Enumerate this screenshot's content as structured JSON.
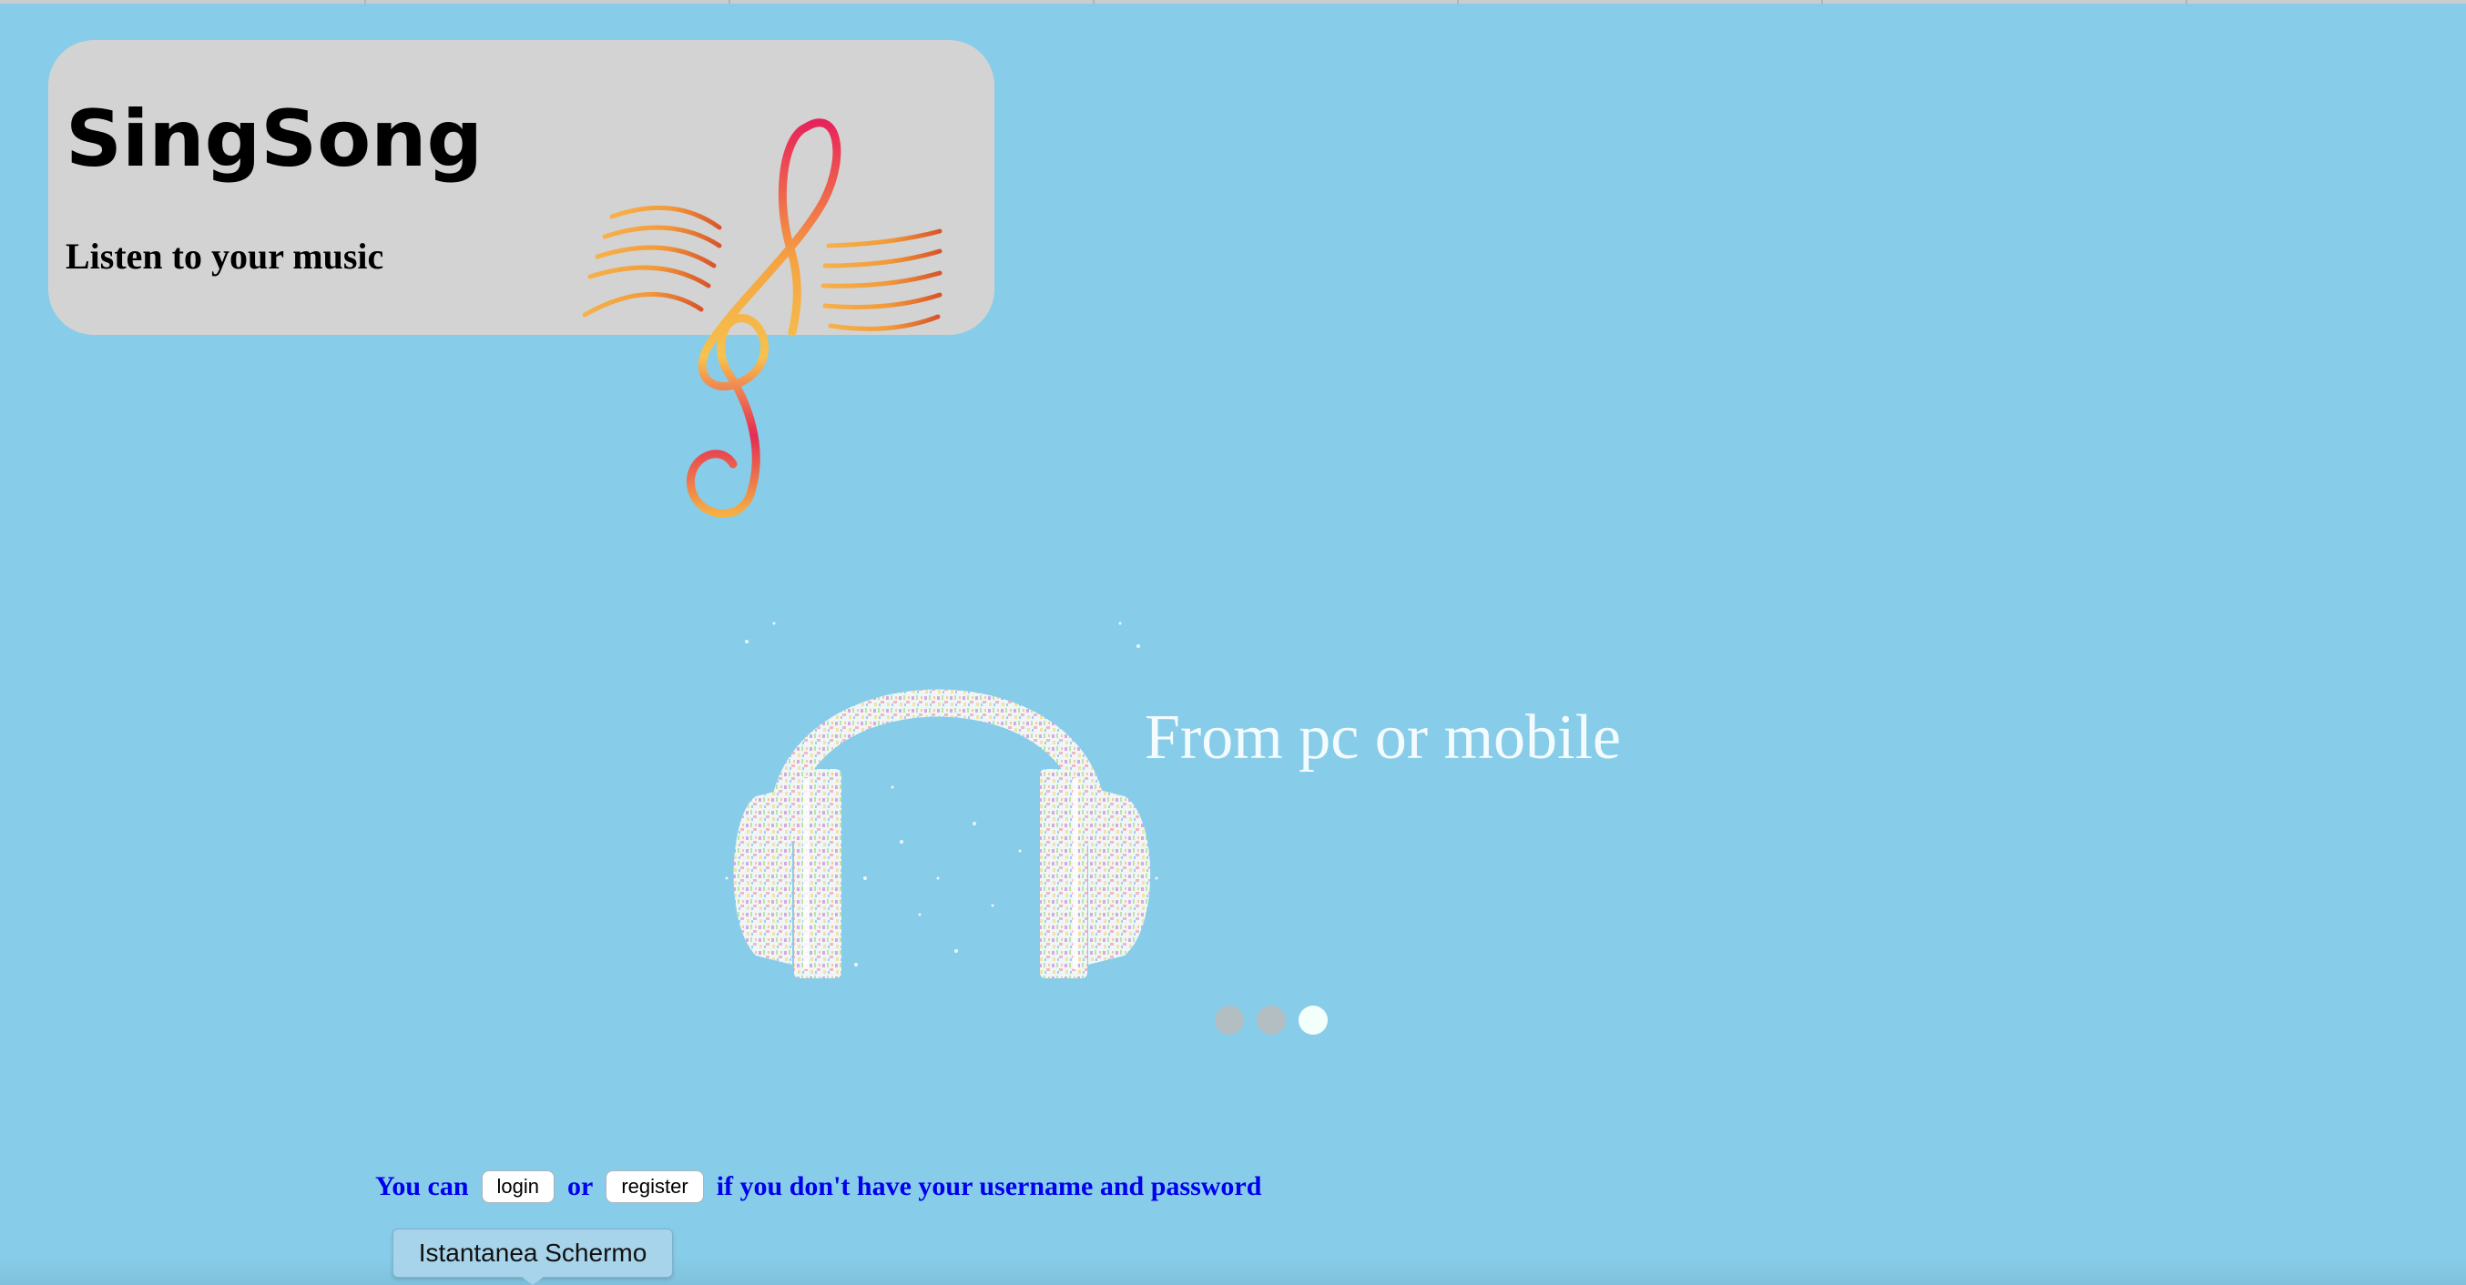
{
  "header": {
    "title": "SingSong",
    "subtitle": "Listen to your music",
    "logo_icon": "treble-clef-icon",
    "background": "#D3D3D3"
  },
  "carousel": {
    "caption": "From pc or mobile",
    "image_icon": "headphones-icon",
    "slide_count": 3,
    "active_slide": 3
  },
  "auth": {
    "prefix": "You can",
    "login_label": "login",
    "connector": "or",
    "register_label": "register",
    "suffix": "if you don't have your username and password",
    "text_color": "#0000EE"
  },
  "tooltip": {
    "text": "Istantanea Schermo"
  },
  "colors": {
    "page_background": "#87CDE9",
    "caption": "#F4FBFF",
    "dot_inactive": "#B2BEC2",
    "dot_active": "#F2FFFB"
  }
}
